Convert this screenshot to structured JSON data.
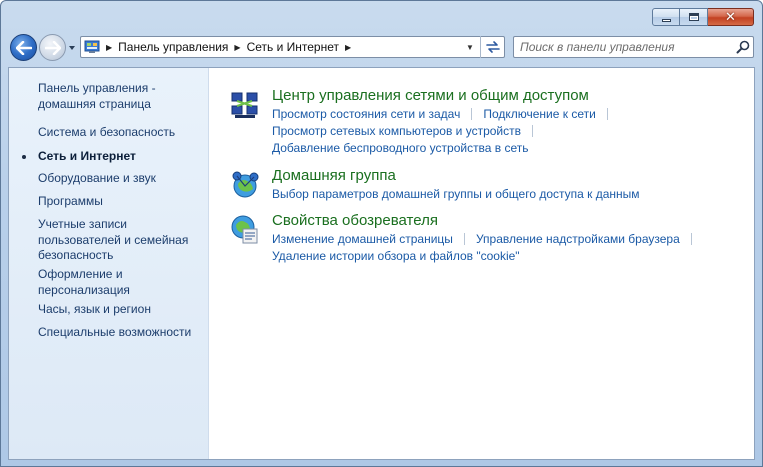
{
  "window": {
    "caption": {
      "minimize": "minimize",
      "maximize": "maximize",
      "close": "close"
    }
  },
  "nav": {
    "breadcrumb": [
      "Панель управления",
      "Сеть и Интернет"
    ],
    "search_placeholder": "Поиск в панели управления"
  },
  "sidebar": {
    "home": "Панель управления - домашняя страница",
    "items": [
      {
        "label": "Система и безопасность",
        "active": false
      },
      {
        "label": "Сеть и Интернет",
        "active": true
      },
      {
        "label": "Оборудование и звук",
        "active": false
      },
      {
        "label": "Программы",
        "active": false
      },
      {
        "label": "Учетные записи пользователей и семейная безопасность",
        "active": false
      },
      {
        "label": "Оформление и персонализация",
        "active": false
      },
      {
        "label": "Часы, язык и регион",
        "active": false
      },
      {
        "label": "Специальные возможности",
        "active": false
      }
    ]
  },
  "sections": [
    {
      "title": "Центр управления сетями и общим доступом",
      "icon": "network-center-icon",
      "links": [
        [
          "Просмотр состояния сети и задач",
          "Подключение к сети"
        ],
        [
          "Просмотр сетевых компьютеров и устройств"
        ],
        [
          "Добавление беспроводного устройства в сеть"
        ]
      ]
    },
    {
      "title": "Домашняя группа",
      "icon": "homegroup-icon",
      "links": [
        [
          "Выбор параметров домашней группы и общего доступа к данным"
        ]
      ]
    },
    {
      "title": "Свойства обозревателя",
      "icon": "internet-options-icon",
      "links": [
        [
          "Изменение домашней страницы",
          "Управление надстройками браузера"
        ],
        [
          "Удаление истории обзора и файлов \"cookie\""
        ]
      ]
    }
  ],
  "colors": {
    "title_green": "#1a6f1f",
    "link_blue": "#1b5aa6",
    "sidebar_text": "#1c3d6c"
  }
}
